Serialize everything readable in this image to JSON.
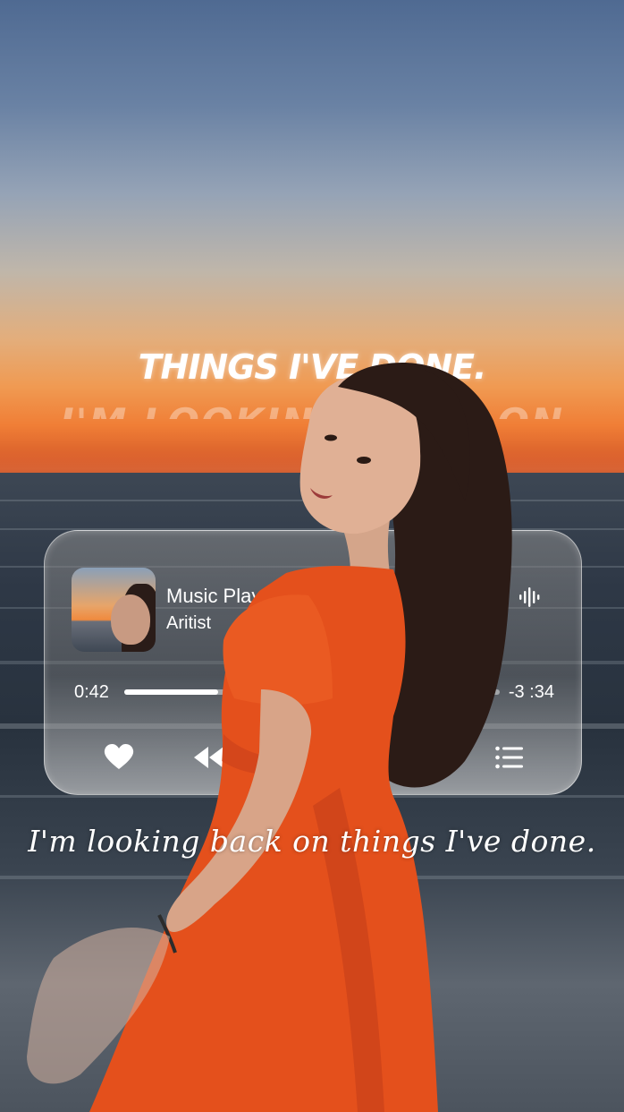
{
  "caption_top": "THINGS I'VE DONE.",
  "caption_ghost": "I'M LOOKING BACK ON",
  "player": {
    "title": "Music Playe",
    "artist": "Aritist",
    "elapsed": "0:42",
    "remaining": "-3 :34",
    "progress_fraction": 0.25,
    "icons": [
      "waveform-icon",
      "heart-icon",
      "rewind-icon",
      "playlist-icon"
    ]
  },
  "lyric": "I'm looking back on things I've done.",
  "colors": {
    "dress": "#e4501c",
    "accent_text": "#ffffff"
  }
}
